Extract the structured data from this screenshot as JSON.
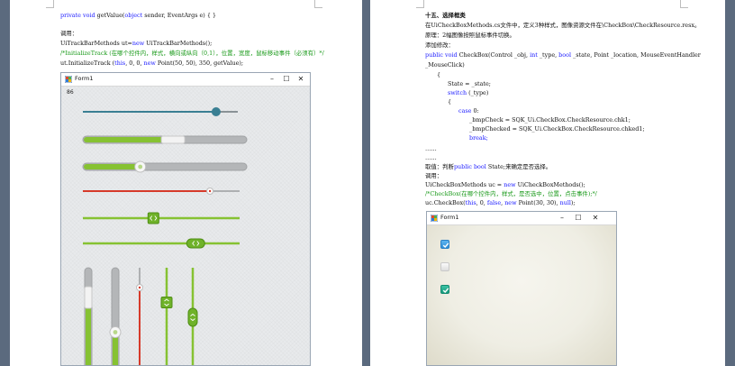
{
  "left_page": {
    "lines": [
      [
        "private void getValue(object sender, EventArgs e) { }"
      ],
      [
        "调用："
      ],
      [
        "UiTrackBarMethods ut=new UiTrackBarMethods();"
      ],
      [
        "/*InitializeTrack    (在哪个控件内，样式，横向或纵向（0,1），位置，宽度，鼠标移动事件（必须有）*/"
      ],
      [
        "ut.InitializeTrack     (this, 0, 0, new Point(50, 50), 350, getValue);"
      ]
    ],
    "form": {
      "title": "Form1",
      "value_label": "86",
      "h_sliders": [
        {
          "style": "thin-blue",
          "value": 0.86
        },
        {
          "style": "green-thick",
          "value": 0.55
        },
        {
          "style": "green-thick-round",
          "value": 0.35
        },
        {
          "style": "red",
          "value": 0.85
        },
        {
          "style": "green-tab",
          "value": 0.45
        },
        {
          "style": "green-pill",
          "value": 0.72
        }
      ],
      "v_sliders": [
        {
          "style": "gray-thick",
          "value": 0.3
        },
        {
          "style": "green-thick-round",
          "value": 0.65
        },
        {
          "style": "red",
          "value": 0.2
        },
        {
          "style": "green-tab",
          "value": 0.35
        },
        {
          "style": "green-pill",
          "value": 0.5
        }
      ]
    }
  },
  "right_page": {
    "lines": [
      "十五、选择框类",
      "在UiCheckBoxMethods.cs文件中，定义3种样式，图像资源文件在\\CheckBox\\CheckResource.resx。",
      "原理：2幅图像按照鼠标事件切换。",
      "添加修改：",
      "public void CheckBox(Control _obj, int _type, bool _state, Point _location, MouseEventHandler",
      "_MouseClick)",
      "{",
      "State = _state;",
      "switch (_type)",
      "{",
      "case 0:",
      "_bmpCheck = SQK_Ui.CheckBox.CheckResource.chk1;",
      "_bmpChecked = SQK_Ui.CheckBox.CheckResource.chked1;",
      "break;",
      "……",
      "……",
      "取值：判断public bool State;来确定是否选择。",
      "调用：",
      "UiCheckBoxMethods uc = new UiCheckBoxMethods();",
      "/*CheckBox(在哪个控件内，样式，是否选中，位置，点击事件);*/",
      "uc.CheckBox(this, 0, false, new Point(30, 30), null);"
    ],
    "form": {
      "title": "Form1",
      "checkboxes": [
        {
          "style": "blue",
          "checked": true
        },
        {
          "style": "gray",
          "checked": false
        },
        {
          "style": "teal",
          "checked": true
        }
      ]
    }
  },
  "colors": {
    "background": "#5b6a7e",
    "keyword": "#1a1aff",
    "comment": "#1a9a1a",
    "slider_blue": "#3a7f93",
    "slider_green": "#86c232",
    "slider_red": "#d63a2a"
  }
}
